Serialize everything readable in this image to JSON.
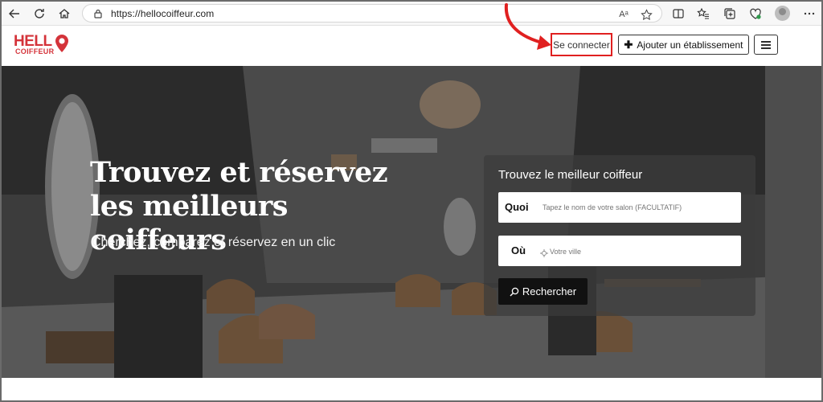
{
  "browser": {
    "url": "https://hellocoiffeur.com",
    "read_aloud_label": "Aᵃ"
  },
  "header": {
    "logo_top": "HELL",
    "logo_bottom": "COIFFEUR",
    "connect_label": "Se connecter",
    "add_label": "Ajouter un établissement"
  },
  "hero": {
    "title": "Trouvez et réservez les meilleurs coiffeurs",
    "subtitle": "Cherchez, comparez et réservez en un clic"
  },
  "search": {
    "card_title": "Trouvez le meilleur coiffeur",
    "what_label": "Quoi",
    "what_placeholder": "Tapez le nom de votre salon (FACULTATIF)",
    "where_label": "Où",
    "where_placeholder": "Votre ville",
    "button_label": "Rechercher"
  },
  "colors": {
    "brand": "#d4333a",
    "highlight": "#e02020"
  }
}
